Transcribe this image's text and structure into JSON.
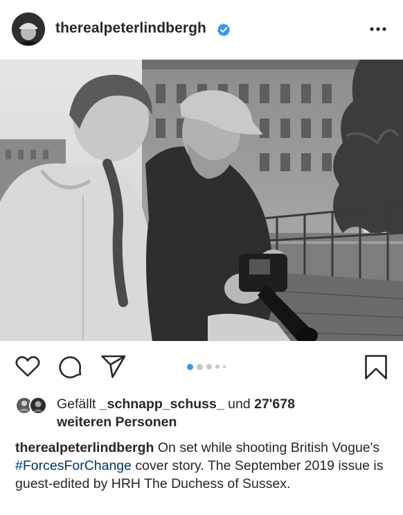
{
  "post": {
    "username": "therealpeterlindbergh",
    "verified": true,
    "colors": {
      "text": "#262626",
      "verified_badge": "#3897f0",
      "active_dot": "#3897f0",
      "inactive_dot": "#c7c7c7",
      "hashtag": "#003569"
    },
    "icons": {
      "more": "more-horizontal-icon",
      "like": "heart-icon",
      "comment": "comment-icon",
      "share": "send-icon",
      "save": "bookmark-icon"
    },
    "carousel": {
      "total": 5,
      "active_index": 0
    }
  },
  "likes": {
    "prefix": "Gefällt",
    "liker": "_schnapp_schuss_",
    "conjunction": "und",
    "count": "27'678",
    "suffix": "weiteren Personen"
  },
  "caption": {
    "username": "therealpeterlindbergh",
    "text_before": "On set while shooting British Vogue's",
    "hashtag": "#ForcesForChange",
    "text_after": "cover story. The September 2019 issue is guest-edited by HRH The Duchess of Sussex."
  }
}
